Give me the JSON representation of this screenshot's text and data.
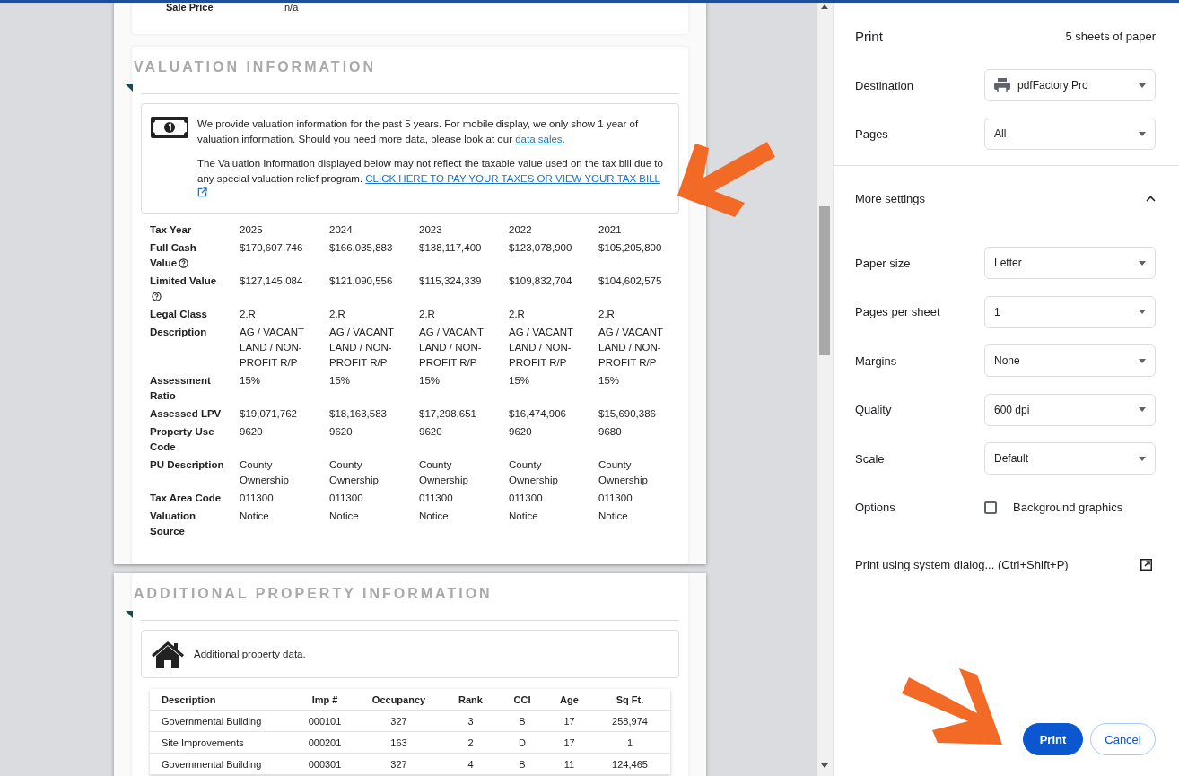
{
  "preview": {
    "sale_price": {
      "label": "Sale Price",
      "value": "n/a"
    },
    "valuation": {
      "title": "VALUATION INFORMATION",
      "note_1": "We provide valuation information for the past 5 years. For mobile display, we only show 1 year of valuation information. Should you need more data, please look at our ",
      "note_1_link": "data sales",
      "note_1_end": ".",
      "note_2": "The Valuation Information displayed below may not reflect the taxable value used on the tax bill due to any special valuation relief program. ",
      "note_2_link": "CLICK HERE TO PAY YOUR TAXES OR VIEW YOUR TAX BILL",
      "rows": [
        {
          "label": "Tax Year",
          "help": false,
          "values": [
            "2025",
            "2024",
            "2023",
            "2022",
            "2021"
          ]
        },
        {
          "label": "Full Cash Value",
          "help": true,
          "values": [
            "$170,607,746",
            "$166,035,883",
            "$138,117,400",
            "$123,078,900",
            "$105,205,800"
          ]
        },
        {
          "label": "Limited Value",
          "help": true,
          "values": [
            "$127,145,084",
            "$121,090,556",
            "$115,324,339",
            "$109,832,704",
            "$104,602,575"
          ]
        },
        {
          "label": "Legal Class",
          "help": false,
          "values": [
            "2.R",
            "2.R",
            "2.R",
            "2.R",
            "2.R"
          ]
        },
        {
          "label": "Description",
          "help": false,
          "values": [
            "AG / VACANT LAND / NON-PROFIT R/P",
            "AG / VACANT LAND / NON-PROFIT R/P",
            "AG / VACANT LAND / NON-PROFIT R/P",
            "AG / VACANT LAND / NON-PROFIT R/P",
            "AG / VACANT LAND / NON-PROFIT R/P"
          ]
        },
        {
          "label": "Assessment Ratio",
          "help": false,
          "values": [
            "15%",
            "15%",
            "15%",
            "15%",
            "15%"
          ]
        },
        {
          "label": "Assessed LPV",
          "help": false,
          "values": [
            "$19,071,762",
            "$18,163,583",
            "$17,298,651",
            "$16,474,906",
            "$15,690,386"
          ]
        },
        {
          "label": "Property Use Code",
          "help": false,
          "values": [
            "9620",
            "9620",
            "9620",
            "9620",
            "9680"
          ]
        },
        {
          "label": "PU Description",
          "help": false,
          "values": [
            "County Ownership",
            "County Ownership",
            "County Ownership",
            "County Ownership",
            "County Ownership"
          ]
        },
        {
          "label": "Tax Area Code",
          "help": false,
          "values": [
            "011300",
            "011300",
            "011300",
            "011300",
            "011300"
          ]
        },
        {
          "label": "Valuation Source",
          "help": false,
          "values": [
            "Notice",
            "Notice",
            "Notice",
            "Notice",
            "Notice"
          ]
        }
      ]
    },
    "additional": {
      "title": "ADDITIONAL PROPERTY INFORMATION",
      "note": "Additional property data.",
      "columns": [
        "Description",
        "Imp #",
        "Occupancy",
        "Rank",
        "CCI",
        "Age",
        "Sq Ft."
      ],
      "rows": [
        [
          "Governmental Building",
          "000101",
          "327",
          "3",
          "B",
          "17",
          "258,974"
        ],
        [
          "Site Improvements",
          "000201",
          "163",
          "2",
          "D",
          "17",
          "1"
        ],
        [
          "Governmental Building",
          "000301",
          "327",
          "4",
          "B",
          "11",
          "124,465"
        ]
      ]
    }
  },
  "print": {
    "title": "Print",
    "sheets": "5 sheets of paper",
    "basic": [
      {
        "label": "Destination",
        "kind": "destination",
        "value": "pdfFactory Pro"
      },
      {
        "label": "Pages",
        "kind": "select",
        "value": "All"
      }
    ],
    "more_settings": {
      "label": "More settings",
      "expanded": true
    },
    "advanced": [
      {
        "label": "Paper size",
        "kind": "select",
        "value": "Letter"
      },
      {
        "label": "Pages per sheet",
        "kind": "select",
        "value": "1"
      },
      {
        "label": "Margins",
        "kind": "select",
        "value": "None"
      },
      {
        "label": "Quality",
        "kind": "select",
        "value": "600 dpi"
      },
      {
        "label": "Scale",
        "kind": "select",
        "value": "Default"
      },
      {
        "label": "Options",
        "kind": "checkbox",
        "value": "Background graphics",
        "checked": false
      }
    ],
    "system_dialog": "Print using system dialog... (Ctrl+Shift+P)",
    "buttons": [
      {
        "label": "Print",
        "kind": "primary"
      },
      {
        "label": "Cancel",
        "kind": "secondary"
      }
    ]
  }
}
